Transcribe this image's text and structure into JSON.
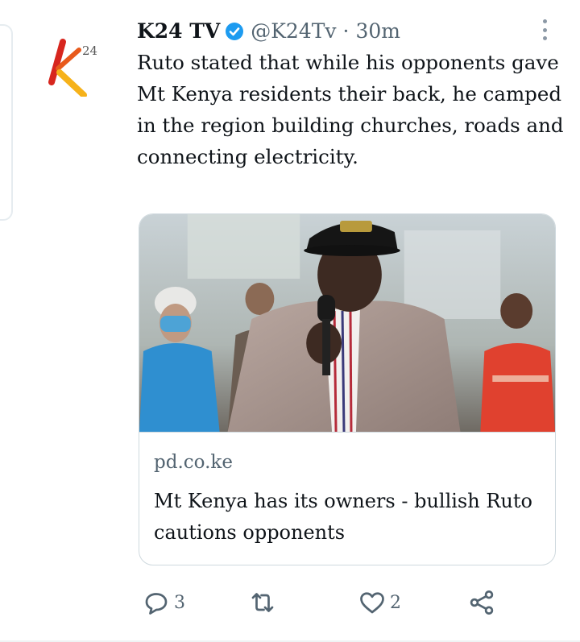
{
  "tweet": {
    "author_name": "K24 TV",
    "handle": "@K24Tv",
    "separator": "·",
    "time": "30m",
    "avatar_label": "24",
    "text": "Ruto stated that while his opponents gave Mt Kenya residents their back, he camped in the region building churches, roads and connecting electricity."
  },
  "link_card": {
    "domain": "pd.co.ke",
    "title": "Mt Kenya has its owners - bullish Ruto cautions opponents"
  },
  "actions": {
    "replies": "3",
    "retweets": "",
    "likes": "2"
  },
  "colors": {
    "verified": "#1d9bf0",
    "muted": "#536471",
    "border": "#cfd9de",
    "logo_orange": "#f39a1e",
    "logo_red": "#d7261e"
  }
}
